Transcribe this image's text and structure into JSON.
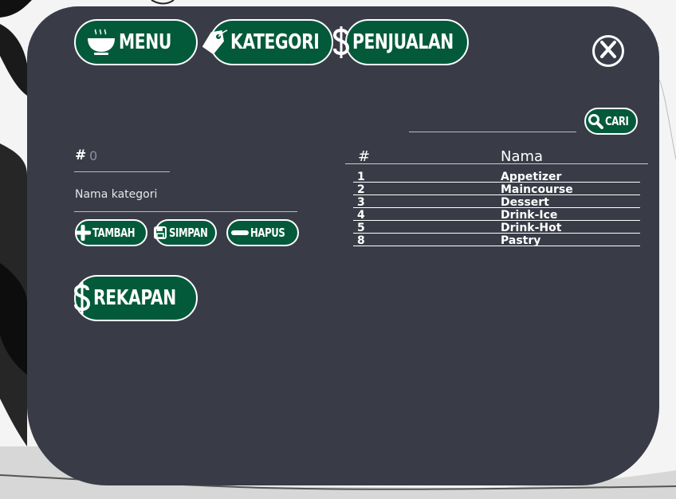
{
  "colors": {
    "panel_bg": "#393c47",
    "button_green": "#035a3a",
    "button_border": "#ffffff",
    "text": "#ffffff"
  },
  "nav": {
    "menu_label": "MENU",
    "menu_icon": "bowl-icon",
    "kategori_label": "KATEGORI",
    "kategori_icon": "tag-icon",
    "penjualan_label": "PENJUALAN",
    "penjualan_icon": "dollar-icon"
  },
  "close_icon": "close-icon",
  "search": {
    "button_label": "CARI",
    "icon": "search-icon",
    "value": ""
  },
  "form": {
    "id_label": "#",
    "id_value": "0",
    "name_placeholder": "Nama kategori",
    "tambah_label": "TAMBAH",
    "simpan_label": "SIMPAN",
    "hapus_label": "HAPUS"
  },
  "rekapan": {
    "label": "REKAPAN",
    "icon": "dollar-icon"
  },
  "table": {
    "headers": [
      "#",
      "Nama"
    ],
    "rows": [
      {
        "id": "1",
        "nama": "Appetizer"
      },
      {
        "id": "2",
        "nama": "Maincourse"
      },
      {
        "id": "3",
        "nama": "Dessert"
      },
      {
        "id": "4",
        "nama": "Drink-Ice"
      },
      {
        "id": "5",
        "nama": "Drink-Hot"
      },
      {
        "id": "8",
        "nama": "Pastry"
      }
    ]
  }
}
